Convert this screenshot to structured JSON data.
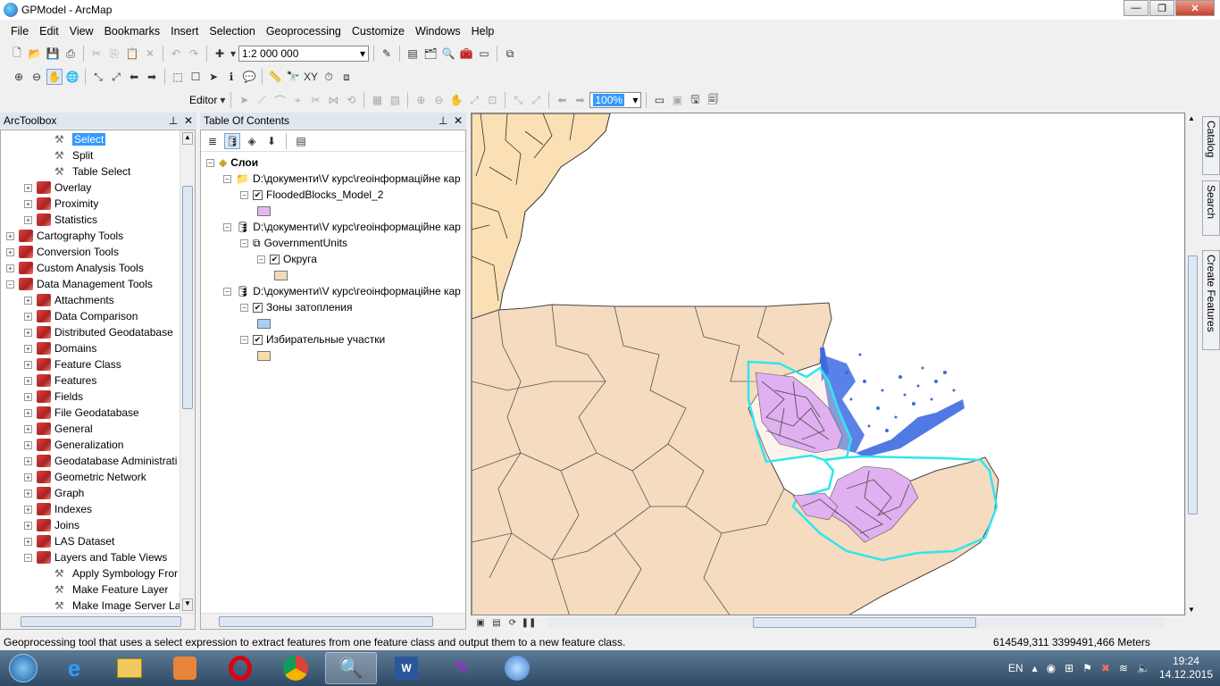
{
  "window": {
    "title": "GPModel - ArcMap",
    "min": "—",
    "max": "❐",
    "close": "✕"
  },
  "menu": [
    "File",
    "Edit",
    "View",
    "Bookmarks",
    "Insert",
    "Selection",
    "Geoprocessing",
    "Customize",
    "Windows",
    "Help"
  ],
  "toolbar": {
    "scale": "1:2 000 000",
    "editor": "Editor",
    "zoom": "100%"
  },
  "toolbox": {
    "header": "ArcToolbox",
    "items": [
      {
        "label": "Select",
        "level": 3,
        "type": "tool",
        "selected": true
      },
      {
        "label": "Split",
        "level": 3,
        "type": "tool"
      },
      {
        "label": "Table Select",
        "level": 3,
        "type": "tool"
      },
      {
        "label": "Overlay",
        "level": 2,
        "type": "set"
      },
      {
        "label": "Proximity",
        "level": 2,
        "type": "set"
      },
      {
        "label": "Statistics",
        "level": 2,
        "type": "set"
      },
      {
        "label": "Cartography Tools",
        "level": 1,
        "type": "set"
      },
      {
        "label": "Conversion Tools",
        "level": 1,
        "type": "set"
      },
      {
        "label": "Custom Analysis Tools",
        "level": 1,
        "type": "set"
      },
      {
        "label": "Data Management Tools",
        "level": 1,
        "type": "set",
        "expanded": true
      },
      {
        "label": "Attachments",
        "level": 2,
        "type": "set"
      },
      {
        "label": "Data Comparison",
        "level": 2,
        "type": "set"
      },
      {
        "label": "Distributed Geodatabase",
        "level": 2,
        "type": "set"
      },
      {
        "label": "Domains",
        "level": 2,
        "type": "set"
      },
      {
        "label": "Feature Class",
        "level": 2,
        "type": "set"
      },
      {
        "label": "Features",
        "level": 2,
        "type": "set"
      },
      {
        "label": "Fields",
        "level": 2,
        "type": "set"
      },
      {
        "label": "File Geodatabase",
        "level": 2,
        "type": "set"
      },
      {
        "label": "General",
        "level": 2,
        "type": "set"
      },
      {
        "label": "Generalization",
        "level": 2,
        "type": "set"
      },
      {
        "label": "Geodatabase Administrati",
        "level": 2,
        "type": "set"
      },
      {
        "label": "Geometric Network",
        "level": 2,
        "type": "set"
      },
      {
        "label": "Graph",
        "level": 2,
        "type": "set"
      },
      {
        "label": "Indexes",
        "level": 2,
        "type": "set"
      },
      {
        "label": "Joins",
        "level": 2,
        "type": "set"
      },
      {
        "label": "LAS Dataset",
        "level": 2,
        "type": "set"
      },
      {
        "label": "Layers and Table Views",
        "level": 2,
        "type": "set",
        "expanded": true
      },
      {
        "label": "Apply Symbology Fror",
        "level": 3,
        "type": "tool"
      },
      {
        "label": "Make Feature Layer",
        "level": 3,
        "type": "tool"
      },
      {
        "label": "Make Image Server Lay",
        "level": 3,
        "type": "tool"
      }
    ]
  },
  "toc": {
    "header": "Table Of Contents",
    "root": "Слои",
    "rows": [
      {
        "kind": "folder",
        "label": "D:\\документи\\V курс\\геоінформаційне кар",
        "indent": 1
      },
      {
        "kind": "layer",
        "label": "FloodedBlocks_Model_2",
        "indent": 2,
        "checked": true
      },
      {
        "kind": "swatch",
        "color": "#e3b7ef",
        "indent": 3
      },
      {
        "kind": "db",
        "label": "D:\\документи\\V курс\\геоінформаційне кар",
        "indent": 1
      },
      {
        "kind": "group",
        "label": "GovernmentUnits",
        "indent": 2
      },
      {
        "kind": "layer",
        "label": "Округа",
        "indent": 3,
        "checked": true
      },
      {
        "kind": "swatch",
        "color": "#f5d9bd",
        "indent": 4
      },
      {
        "kind": "db",
        "label": "D:\\документи\\V курс\\геоінформаційне кар",
        "indent": 1
      },
      {
        "kind": "layer",
        "label": "Зоны затопления",
        "indent": 2,
        "checked": true
      },
      {
        "kind": "swatch",
        "color": "#a6cff5",
        "indent": 3
      },
      {
        "kind": "layer",
        "label": "Избирательные участки",
        "indent": 2,
        "checked": true
      },
      {
        "kind": "swatch",
        "color": "#f6dcaa",
        "indent": 3
      }
    ]
  },
  "sidetabs": [
    "Catalog",
    "Search",
    "Create Features"
  ],
  "status": {
    "message": "Geoprocessing tool that uses a select expression to extract features from one feature class and output them to a new feature class.",
    "coords": "614549,311  3399491,466 Meters"
  },
  "tray": {
    "lang": "EN",
    "time": "19:24",
    "date": "14.12.2015"
  },
  "colors": {
    "land": "#f5dbbf",
    "parish": "#fae0b4",
    "flood": "#3d6be0",
    "selected": "#2ee6f0",
    "blocks": "#e0b0f0"
  }
}
